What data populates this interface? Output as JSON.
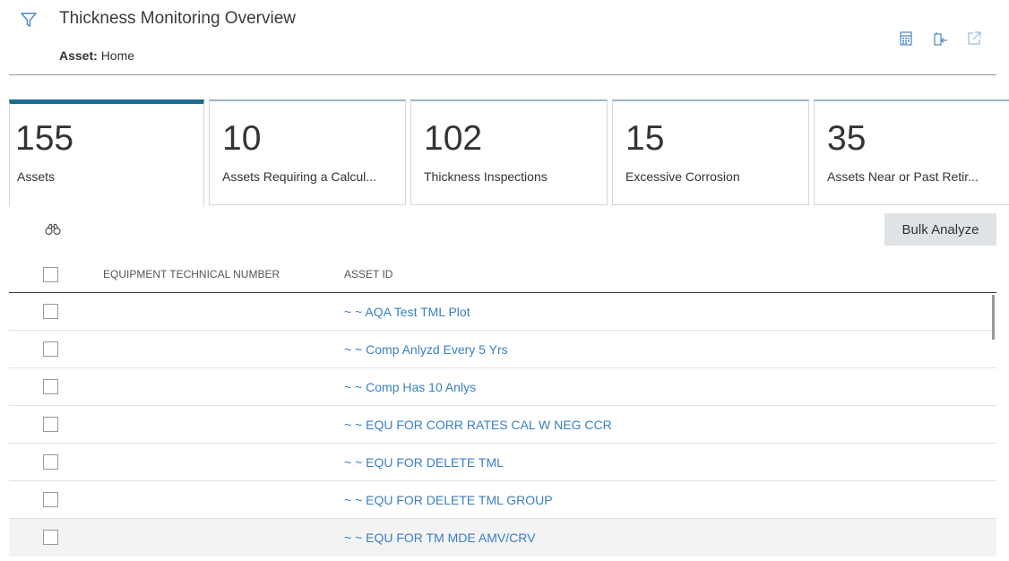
{
  "header": {
    "title": "Thickness Monitoring Overview",
    "asset_label": "Asset:",
    "asset_value": "Home",
    "icons": [
      "filter-icon",
      "calendar-icon",
      "return-icon",
      "open-external-icon"
    ]
  },
  "tiles": [
    {
      "count": "155",
      "label": "Assets",
      "active": true
    },
    {
      "count": "10",
      "label": "Assets Requiring a Calcul...",
      "active": false
    },
    {
      "count": "102",
      "label": "Thickness Inspections",
      "active": false
    },
    {
      "count": "15",
      "label": "Excessive Corrosion",
      "active": false
    },
    {
      "count": "35",
      "label": "Assets Near or Past Retir...",
      "active": false
    }
  ],
  "toolbar": {
    "search_icon": "binoculars-icon",
    "bulk_analyze_label": "Bulk Analyze"
  },
  "grid": {
    "columns": [
      "EQUIPMENT TECHNICAL NUMBER",
      "ASSET ID"
    ],
    "rows": [
      {
        "etn": "",
        "asset_id": "~ ~ AQA Test TML Plot"
      },
      {
        "etn": "",
        "asset_id": "~ ~ Comp Anlyzd Every 5 Yrs"
      },
      {
        "etn": "",
        "asset_id": "~ ~ Comp Has 10 Anlys"
      },
      {
        "etn": "",
        "asset_id": "~ ~ EQU FOR CORR RATES CAL W NEG CCR"
      },
      {
        "etn": "",
        "asset_id": "~ ~ EQU FOR DELETE TML"
      },
      {
        "etn": "",
        "asset_id": "~ ~ EQU FOR DELETE TML GROUP"
      },
      {
        "etn": "",
        "asset_id": "~ ~ EQU FOR TM MDE AMV/CRV"
      }
    ]
  },
  "colors": {
    "accent": "#1a6e8d",
    "link": "#3a7fc1",
    "icon": "#4a86c5"
  }
}
